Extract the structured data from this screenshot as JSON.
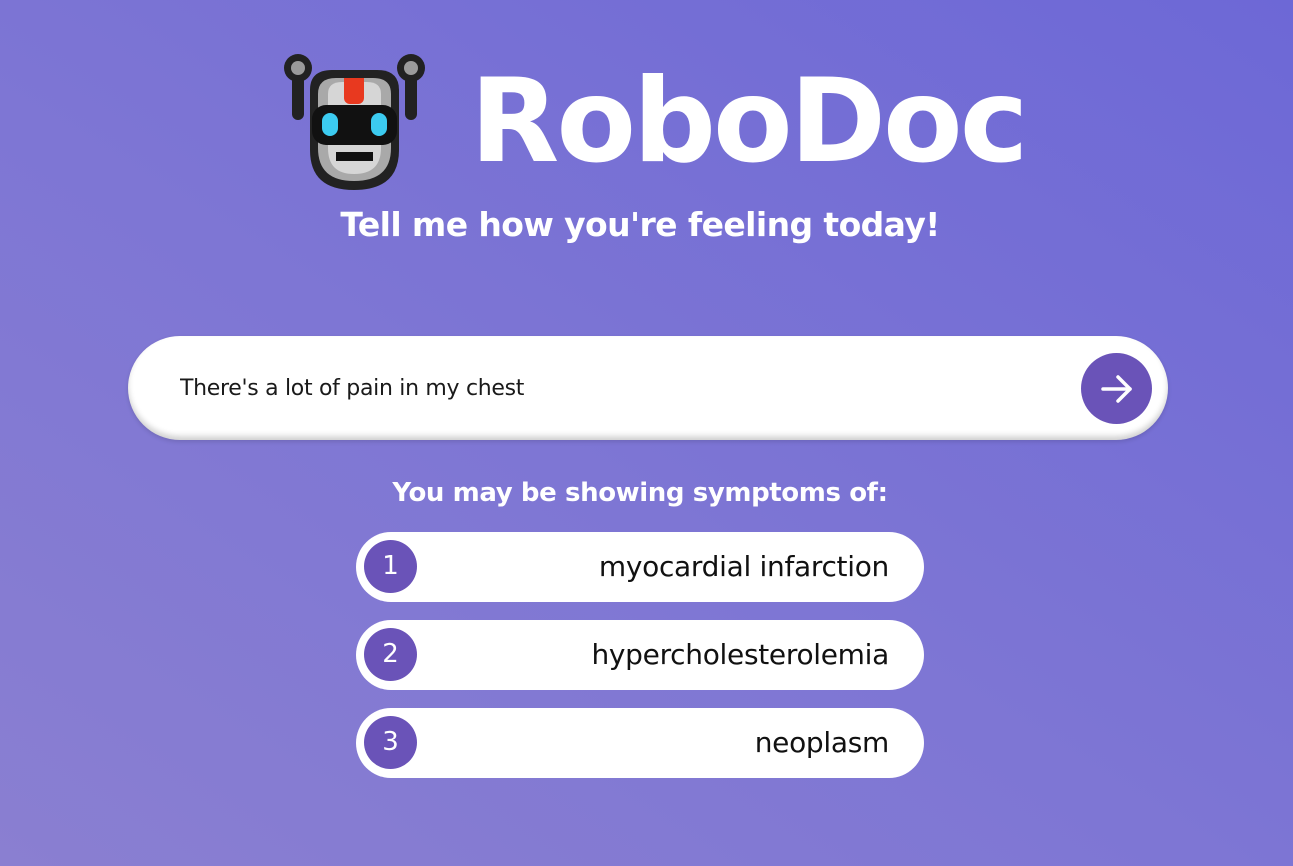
{
  "header": {
    "logo_icon": "robot-face-icon",
    "title": "RoboDoc",
    "tagline": "Tell me how you're feeling today!"
  },
  "search": {
    "value": "There's a lot of pain in my chest",
    "placeholder": "",
    "submit_icon": "arrow-right-icon"
  },
  "results": {
    "heading": "You may be showing symptoms of:",
    "items": [
      {
        "rank": "1",
        "condition": "myocardial infarction"
      },
      {
        "rank": "2",
        "condition": "hypercholesterolemia"
      },
      {
        "rank": "3",
        "condition": "neoplasm"
      }
    ]
  },
  "colors": {
    "background_start": "#8a7fd1",
    "background_end": "#6d68d6",
    "accent": "#6a53b8",
    "text_on_accent": "#ffffff"
  }
}
